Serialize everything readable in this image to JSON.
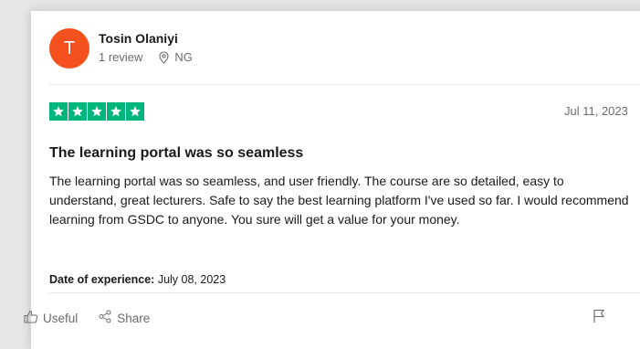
{
  "reviewer": {
    "initial": "T",
    "name": "Tosin Olaniyi",
    "review_count": "1 review",
    "location": "NG",
    "avatar_color": "#f4511e"
  },
  "review": {
    "rating": 5,
    "star_color": "#00b67a",
    "date": "Jul 11, 2023",
    "title": "The learning portal was so seamless",
    "body": "The learning portal was so seamless, and user friendly. The course are so detailed, easy to understand, great lecturers. Safe to say the best learning platform I've used so far. I would recommend learning from GSDC to anyone. You sure will get a value for your money.",
    "experience_label": "Date of experience:",
    "experience_date": "July 08, 2023"
  },
  "actions": {
    "useful_label": "Useful",
    "share_label": "Share"
  },
  "icons": [
    "location-pin-icon",
    "star-icon",
    "thumbs-up-icon",
    "share-icon",
    "flag-icon"
  ]
}
